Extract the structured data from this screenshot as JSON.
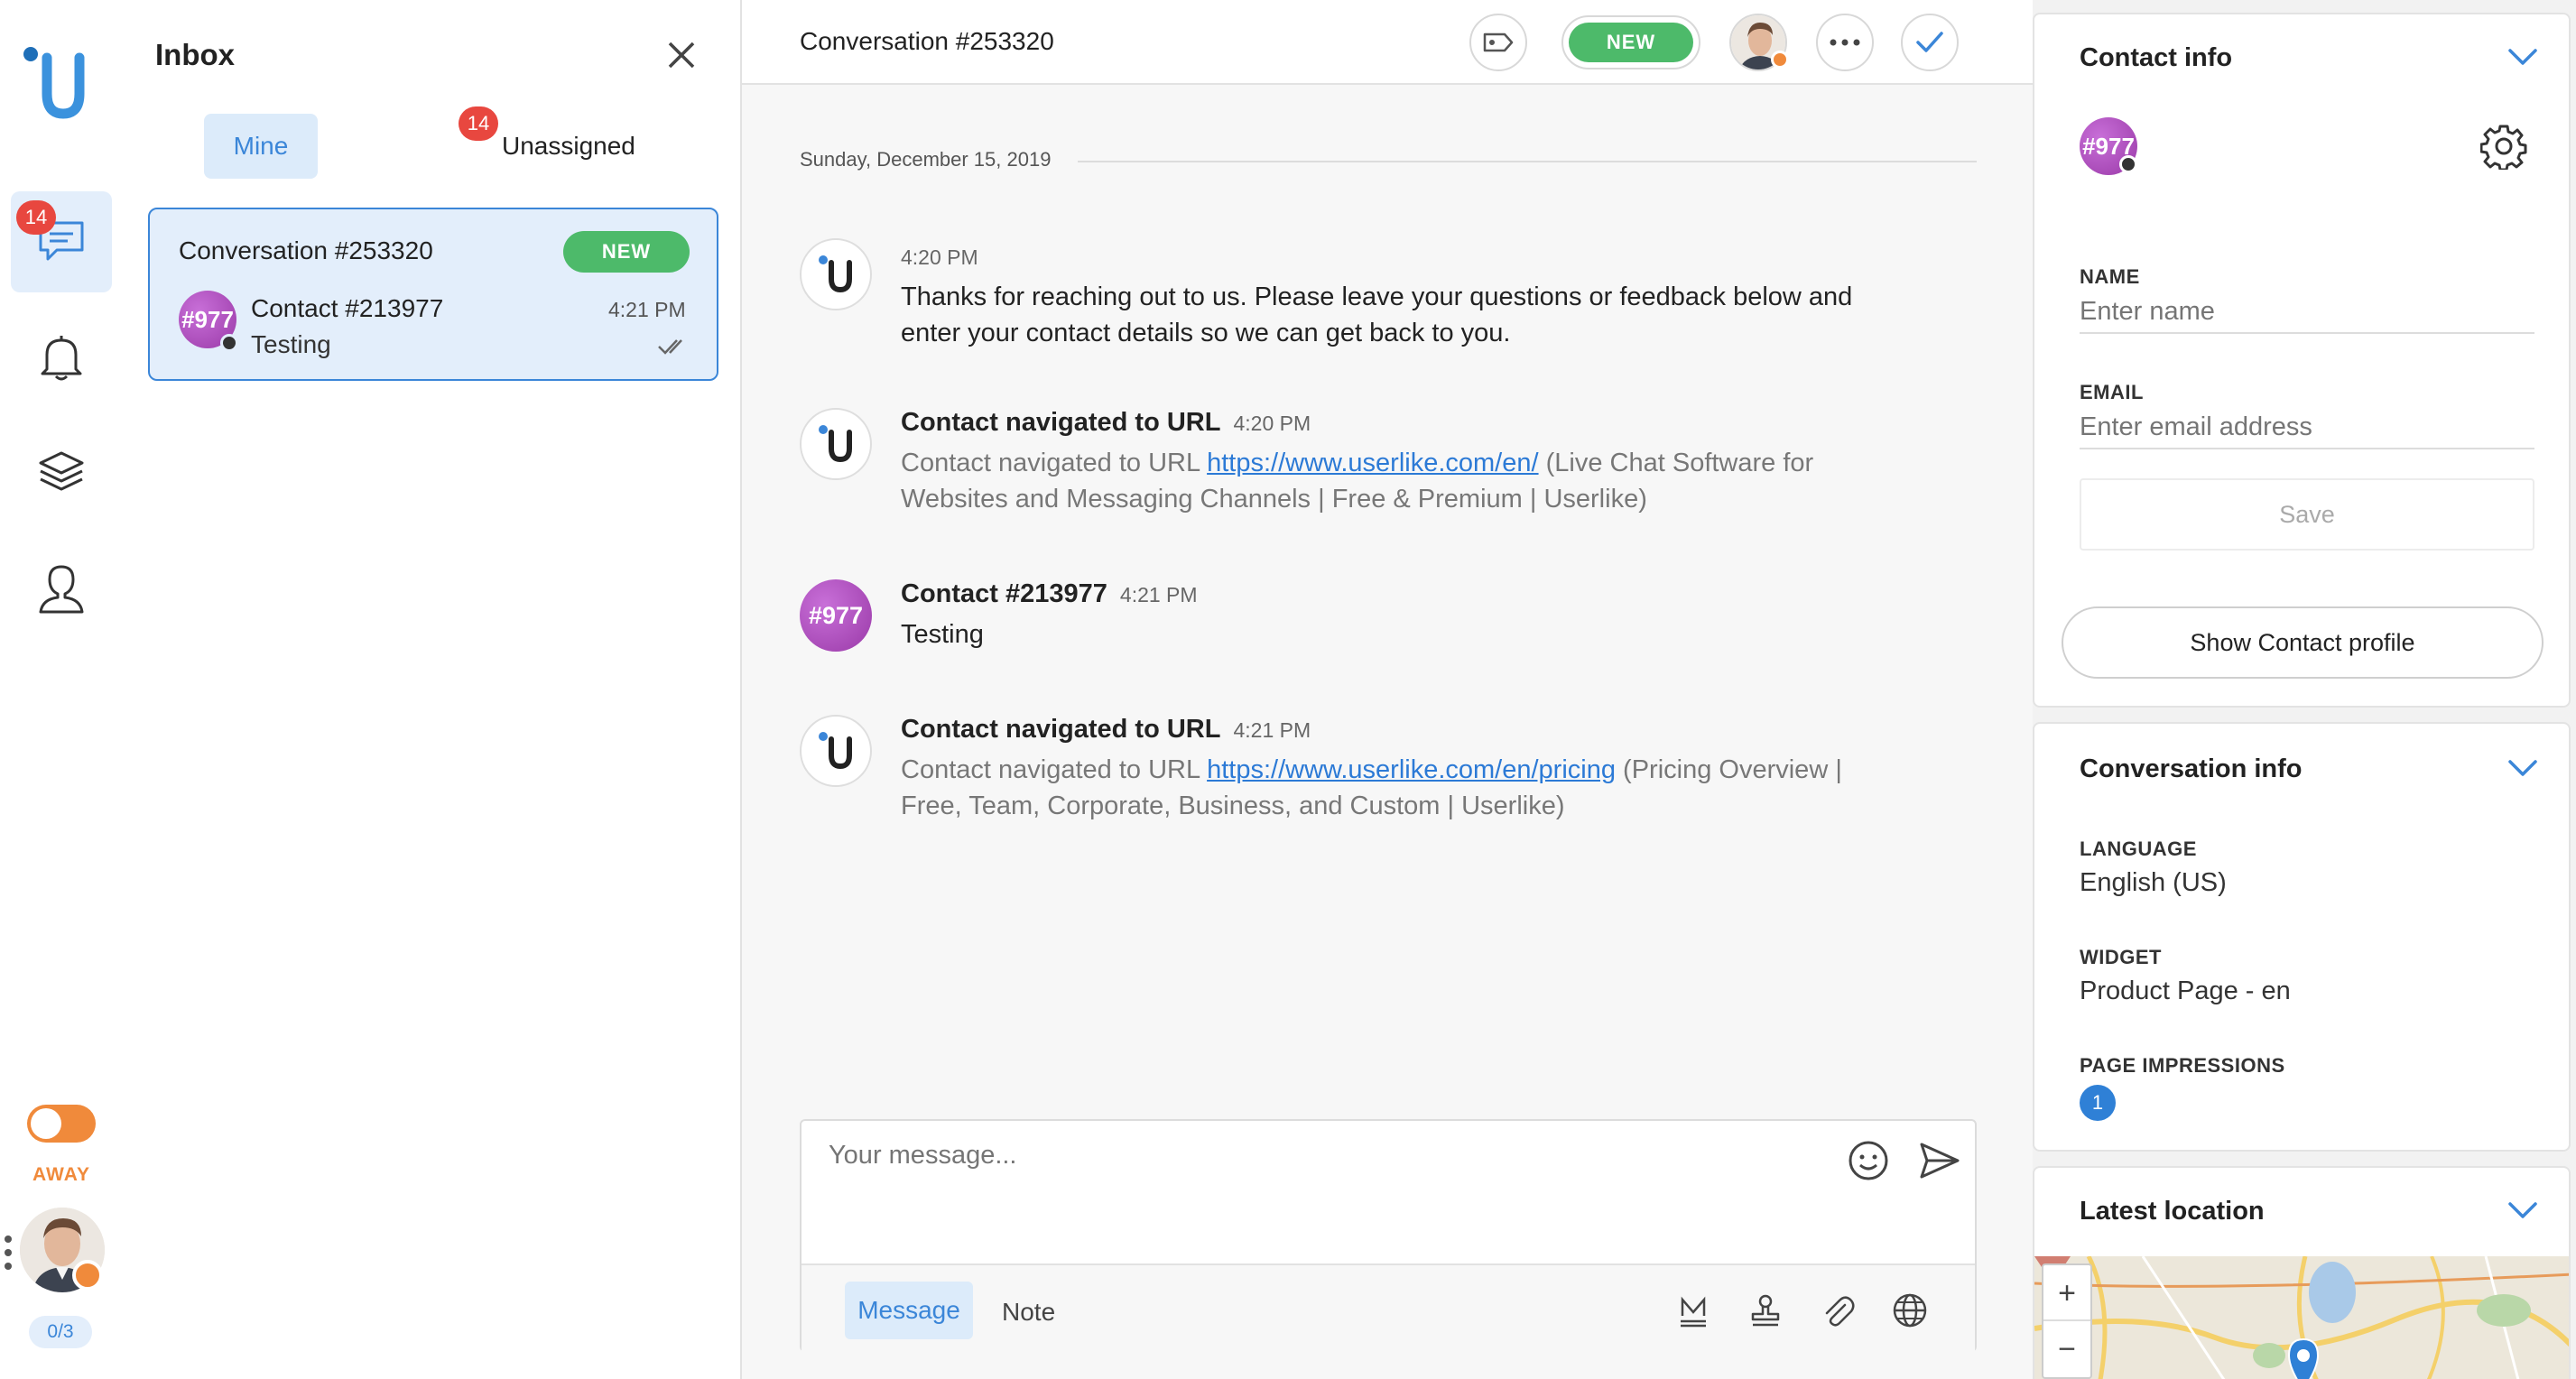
{
  "sidebar": {
    "chat_badge": "14",
    "status_label": "AWAY",
    "capacity": "0/3",
    "colors": {
      "accent": "#3b86d8",
      "away": "#f08a3b",
      "badge": "#e8473f"
    }
  },
  "inbox": {
    "title": "Inbox",
    "tabs": [
      {
        "label": "Mine"
      },
      {
        "label": "Unassigned",
        "badge": "14"
      }
    ],
    "conversation": {
      "title": "Conversation #253320",
      "status": "NEW",
      "avatar_text": "#977",
      "contact": "Contact #213977",
      "time": "4:21 PM",
      "preview": "Testing"
    }
  },
  "header": {
    "title": "Conversation #253320",
    "status": "NEW"
  },
  "chat": {
    "date_divider": "Sunday, December 15, 2019",
    "messages": [
      {
        "time": "4:20 PM",
        "text_line1": "Thanks for reaching out to us. Please leave your questions or feedback below and",
        "text_line2": "enter your contact details so we can get back to you."
      },
      {
        "title": "Contact navigated to URL",
        "time": "4:20 PM",
        "prefix": "Contact navigated to URL ",
        "url": "https://www.userlike.com/en/",
        "suffix1": " (Live Chat Software for",
        "line2": "Websites and Messaging Channels | Free & Premium | Userlike)"
      },
      {
        "avatar_text": "#977",
        "title": "Contact #213977",
        "time": "4:21 PM",
        "text": "Testing"
      },
      {
        "title": "Contact navigated to URL",
        "time": "4:21 PM",
        "prefix": "Contact navigated to URL ",
        "url": "https://www.userlike.com/en/pricing",
        "suffix1": " (Pricing Overview |",
        "line2": "Free, Team, Corporate, Business, and Custom | Userlike)"
      }
    ]
  },
  "composer": {
    "placeholder": "Your message...",
    "tabs": [
      "Message",
      "Note"
    ]
  },
  "contact_info": {
    "title": "Contact info",
    "avatar_text": "#977",
    "name_label": "NAME",
    "name_placeholder": "Enter name",
    "email_label": "EMAIL",
    "email_placeholder": "Enter email address",
    "save_label": "Save",
    "profile_button": "Show Contact profile"
  },
  "conversation_info": {
    "title": "Conversation info",
    "language_label": "LANGUAGE",
    "language": "English (US)",
    "widget_label": "WIDGET",
    "widget": "Product Page - en",
    "impressions_label": "PAGE IMPRESSIONS",
    "impressions": "1"
  },
  "location": {
    "title": "Latest location",
    "zoom_in": "+",
    "zoom_out": "−"
  }
}
